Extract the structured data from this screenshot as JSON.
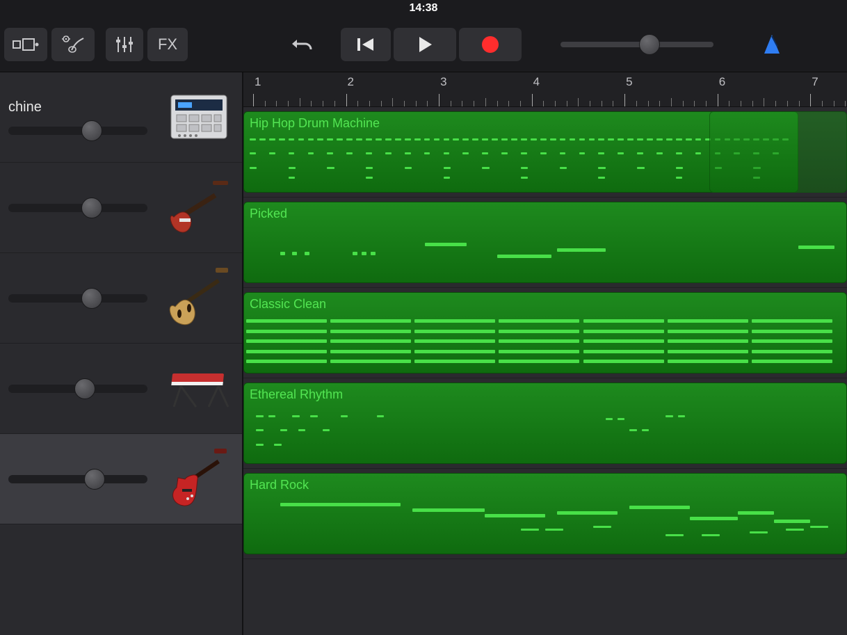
{
  "statusbar": {
    "time": "14:38"
  },
  "toolbar": {
    "fx_label": "FX",
    "master_volume_pct": 58
  },
  "ruler": {
    "bars": [
      1,
      2,
      3,
      4,
      5,
      6,
      7
    ]
  },
  "track_panel": {
    "visible_header_track_name_partial": "chine"
  },
  "tracks": [
    {
      "name": "Hip Hop Drum Machine",
      "instrument": "drum-machine",
      "volume_pct": 60,
      "selected": false,
      "region": {
        "label": "Hip Hop Drum Machine",
        "start_bar": 1,
        "end_bar": 7.4,
        "pattern": "dense-8th-hats-kick-snare",
        "section2_start_bar": 6
      }
    },
    {
      "name": "Picked",
      "instrument": "bass-guitar",
      "volume_pct": 60,
      "selected": false,
      "region": {
        "label": "Picked",
        "start_bar": 1,
        "end_bar": 7.4,
        "pattern": "sparse-notes-bar2-4"
      }
    },
    {
      "name": "Classic Clean",
      "instrument": "semi-hollow-guitar",
      "volume_pct": 60,
      "selected": false,
      "region": {
        "label": "Classic Clean",
        "start_bar": 1,
        "end_bar": 7.4,
        "pattern": "sustained-chords-continuous"
      }
    },
    {
      "name": "Ethereal Rhythm",
      "instrument": "keyboard",
      "volume_pct": 55,
      "selected": false,
      "region": {
        "label": "Ethereal Rhythm",
        "start_bar": 1,
        "end_bar": 7.4,
        "pattern": "sparse-dotted-notes"
      }
    },
    {
      "name": "Hard Rock",
      "instrument": "electric-guitar-sg",
      "volume_pct": 62,
      "selected": true,
      "region": {
        "label": "Hard Rock",
        "start_bar": 1,
        "end_bar": 7.4,
        "pattern": "sustained-and-melodic"
      }
    }
  ],
  "colors": {
    "region_green": "#1e8a1e",
    "note_green": "#48e048",
    "accent_blue": "#2f7df2",
    "record_red": "#ff2d2d"
  }
}
